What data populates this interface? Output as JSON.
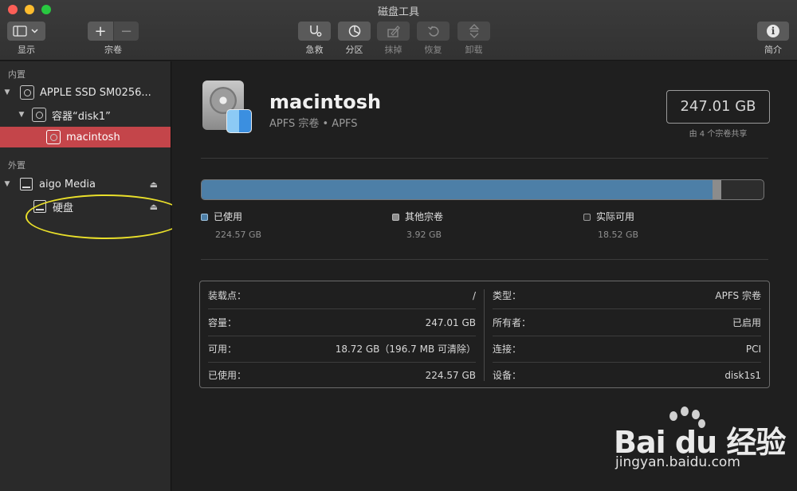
{
  "window": {
    "title": "磁盘工具"
  },
  "toolbar": {
    "view_label": "显示",
    "volume_label": "宗卷",
    "add_symbol": "+",
    "remove_symbol": "−",
    "first_aid_label": "急救",
    "partition_label": "分区",
    "erase_label": "抹掉",
    "restore_label": "恢复",
    "unmount_label": "卸载",
    "info_label": "简介",
    "info_symbol": "i"
  },
  "sidebar": {
    "internal_header": "内置",
    "external_header": "外置",
    "items": [
      {
        "label": "APPLE SSD SM0256...",
        "kind": "disk"
      },
      {
        "label": "容器“disk1”",
        "kind": "container"
      },
      {
        "label": "macintosh",
        "kind": "volume",
        "selected": true
      },
      {
        "label": "aigo Media",
        "kind": "disk"
      },
      {
        "label": "硬盘",
        "kind": "volume"
      }
    ],
    "eject_symbol": "⏏"
  },
  "volume": {
    "name": "macintosh",
    "subtitle": "APFS 宗卷 • APFS",
    "capacity": "247.01 GB",
    "capacity_note": "由 4 个宗卷共享"
  },
  "usage": {
    "used_fraction": 0.9092,
    "other_fraction": 0.0159,
    "legend": [
      {
        "name": "已使用",
        "value": "224.57 GB",
        "color": "#4d7fa7"
      },
      {
        "name": "其他宗卷",
        "value": "3.92 GB",
        "color": "#8c8c8c"
      },
      {
        "name": "实际可用",
        "value": "18.52 GB",
        "color": "#2d2d2d"
      }
    ]
  },
  "info": {
    "left": [
      {
        "key": "装载点：",
        "value": "/"
      },
      {
        "key": "容量：",
        "value": "247.01 GB"
      },
      {
        "key": "可用：",
        "value": "18.72 GB（196.7 MB 可清除）"
      },
      {
        "key": "已使用：",
        "value": "224.57 GB"
      }
    ],
    "right": [
      {
        "key": "类型：",
        "value": "APFS 宗卷"
      },
      {
        "key": "所有者：",
        "value": "已启用"
      },
      {
        "key": "连接：",
        "value": "PCI"
      },
      {
        "key": "设备：",
        "value": "disk1s1"
      }
    ]
  },
  "watermark": {
    "brand": "Bai du 经验",
    "url": "jingyan.baidu.com"
  },
  "colors": {
    "selection": "#c4454a",
    "annotation_ellipse": "#e9df2a"
  }
}
